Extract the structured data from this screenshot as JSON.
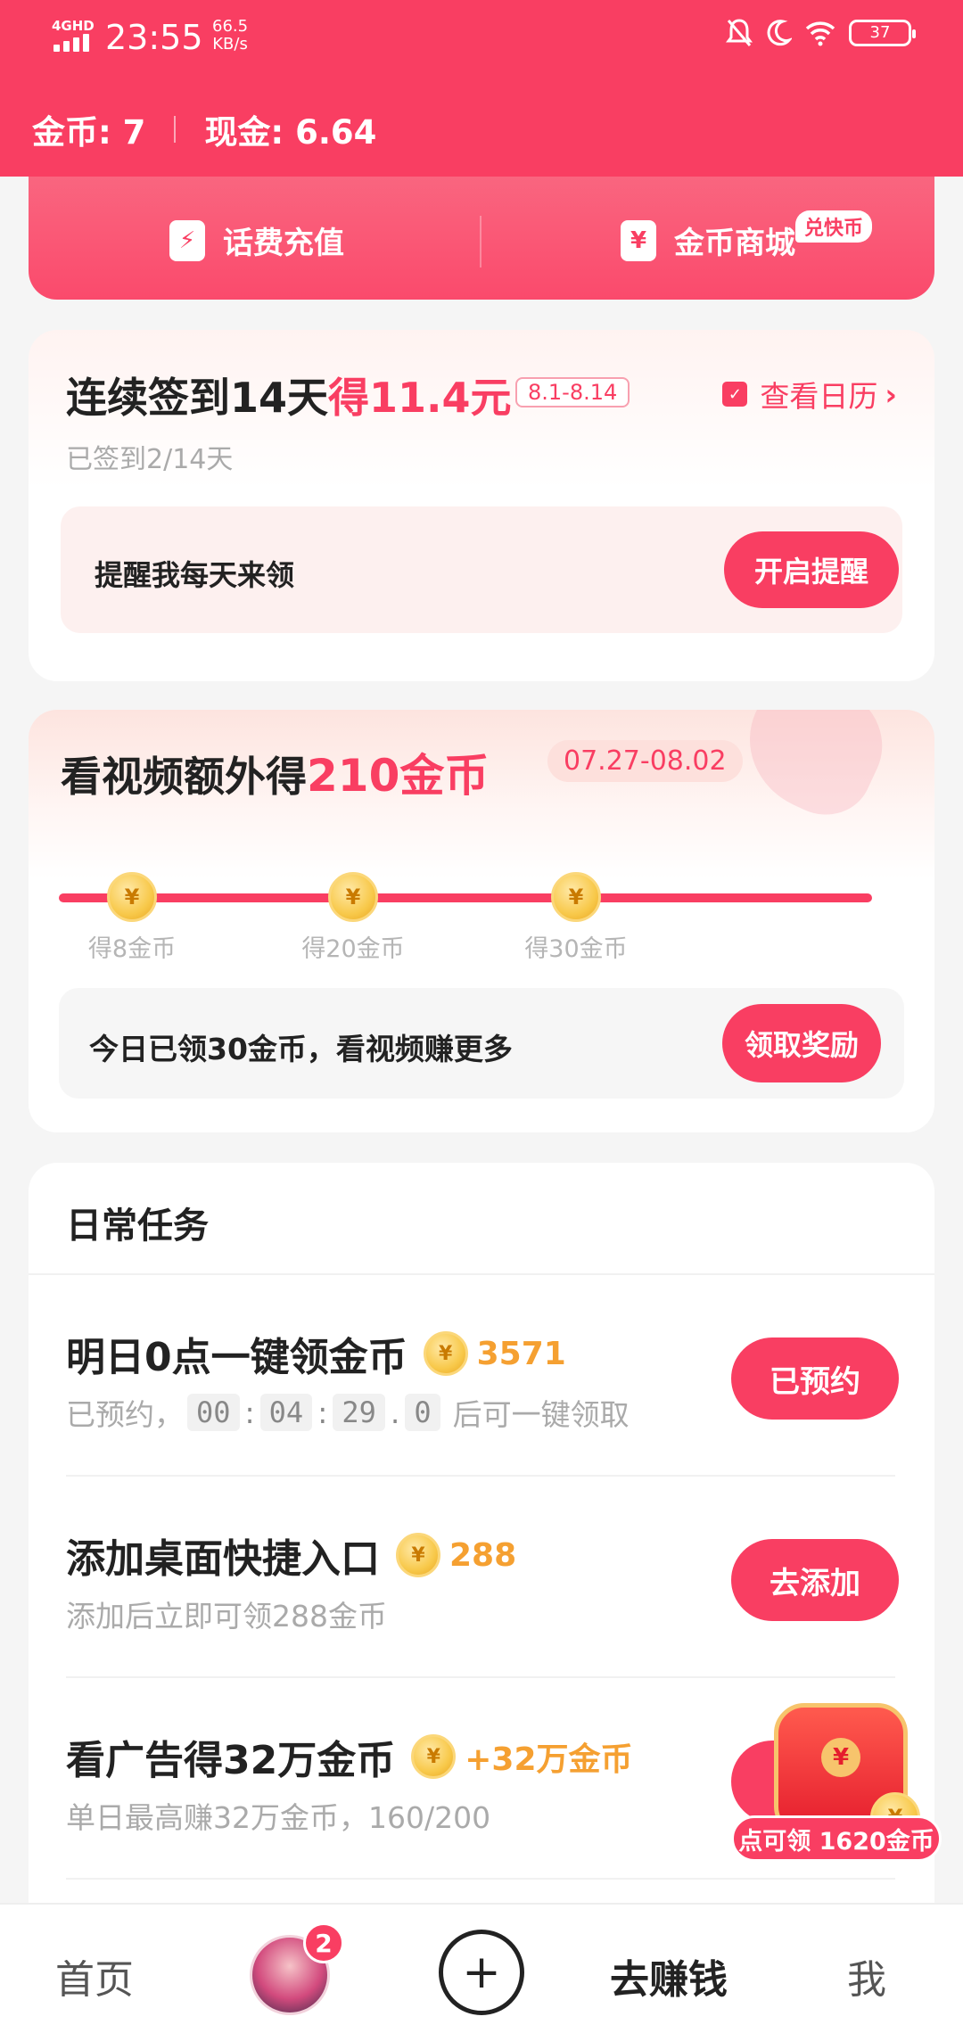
{
  "status_bar": {
    "network": "4GHD",
    "time": "23:55",
    "speed_value": "66.5",
    "speed_unit": "KB/s",
    "battery": "37",
    "icons": [
      "mute-bell-icon",
      "moon-icon",
      "wifi-icon",
      "battery-icon"
    ]
  },
  "wallet": {
    "coins": "金币: 7",
    "cash": "现金: 6.64"
  },
  "quick_entries": [
    {
      "label": "话费充值",
      "icon": "lightning-icon"
    },
    {
      "label": "金币商城",
      "icon": "yen-ticket-icon",
      "badge": "兑快币"
    }
  ],
  "signin": {
    "title_prefix": "连续签到14天",
    "title_highlight": "得11.4元",
    "date_tag": "8.1-8.14",
    "calendar_link": "查看日历",
    "progress_text": "已签到2/14天",
    "reminder_text": "提醒我每天来领",
    "reminder_button": "开启提醒"
  },
  "video_bonus": {
    "title_prefix": "看视频额外得",
    "title_highlight": "210金币",
    "date_tag": "07.27-08.02",
    "milestones": [
      "得8金币",
      "得20金币",
      "得30金币"
    ],
    "progress_fraction": 1.0,
    "claim_text": "今日已领30金币，看视频赚更多",
    "claim_button": "领取奖励"
  },
  "daily_tasks": {
    "heading": "日常任务",
    "tasks": [
      {
        "name": "明日0点一键领金币",
        "reward": "3571",
        "desc_prefix": "已预约，",
        "countdown": [
          "00",
          "04",
          "29",
          "0"
        ],
        "desc_suffix": "后可一键领取",
        "button": "已预约"
      },
      {
        "name": "添加桌面快捷入口",
        "reward": "288",
        "desc": "添加后立即可领288金币",
        "button": "去添加"
      },
      {
        "name": "看广告得32万金币",
        "reward": "+32万金币",
        "desc": "单日最高赚32万金币，160/200",
        "button": ""
      }
    ]
  },
  "floating_redpack": {
    "label": "点可领 1620金币"
  },
  "bottom_nav": {
    "home": "首页",
    "avatar_badge": "2",
    "earn": "去赚钱",
    "me": "我"
  },
  "colors": {
    "brand": "#f93e62",
    "coin": "#f5a031",
    "muted": "#aaaaaa"
  }
}
